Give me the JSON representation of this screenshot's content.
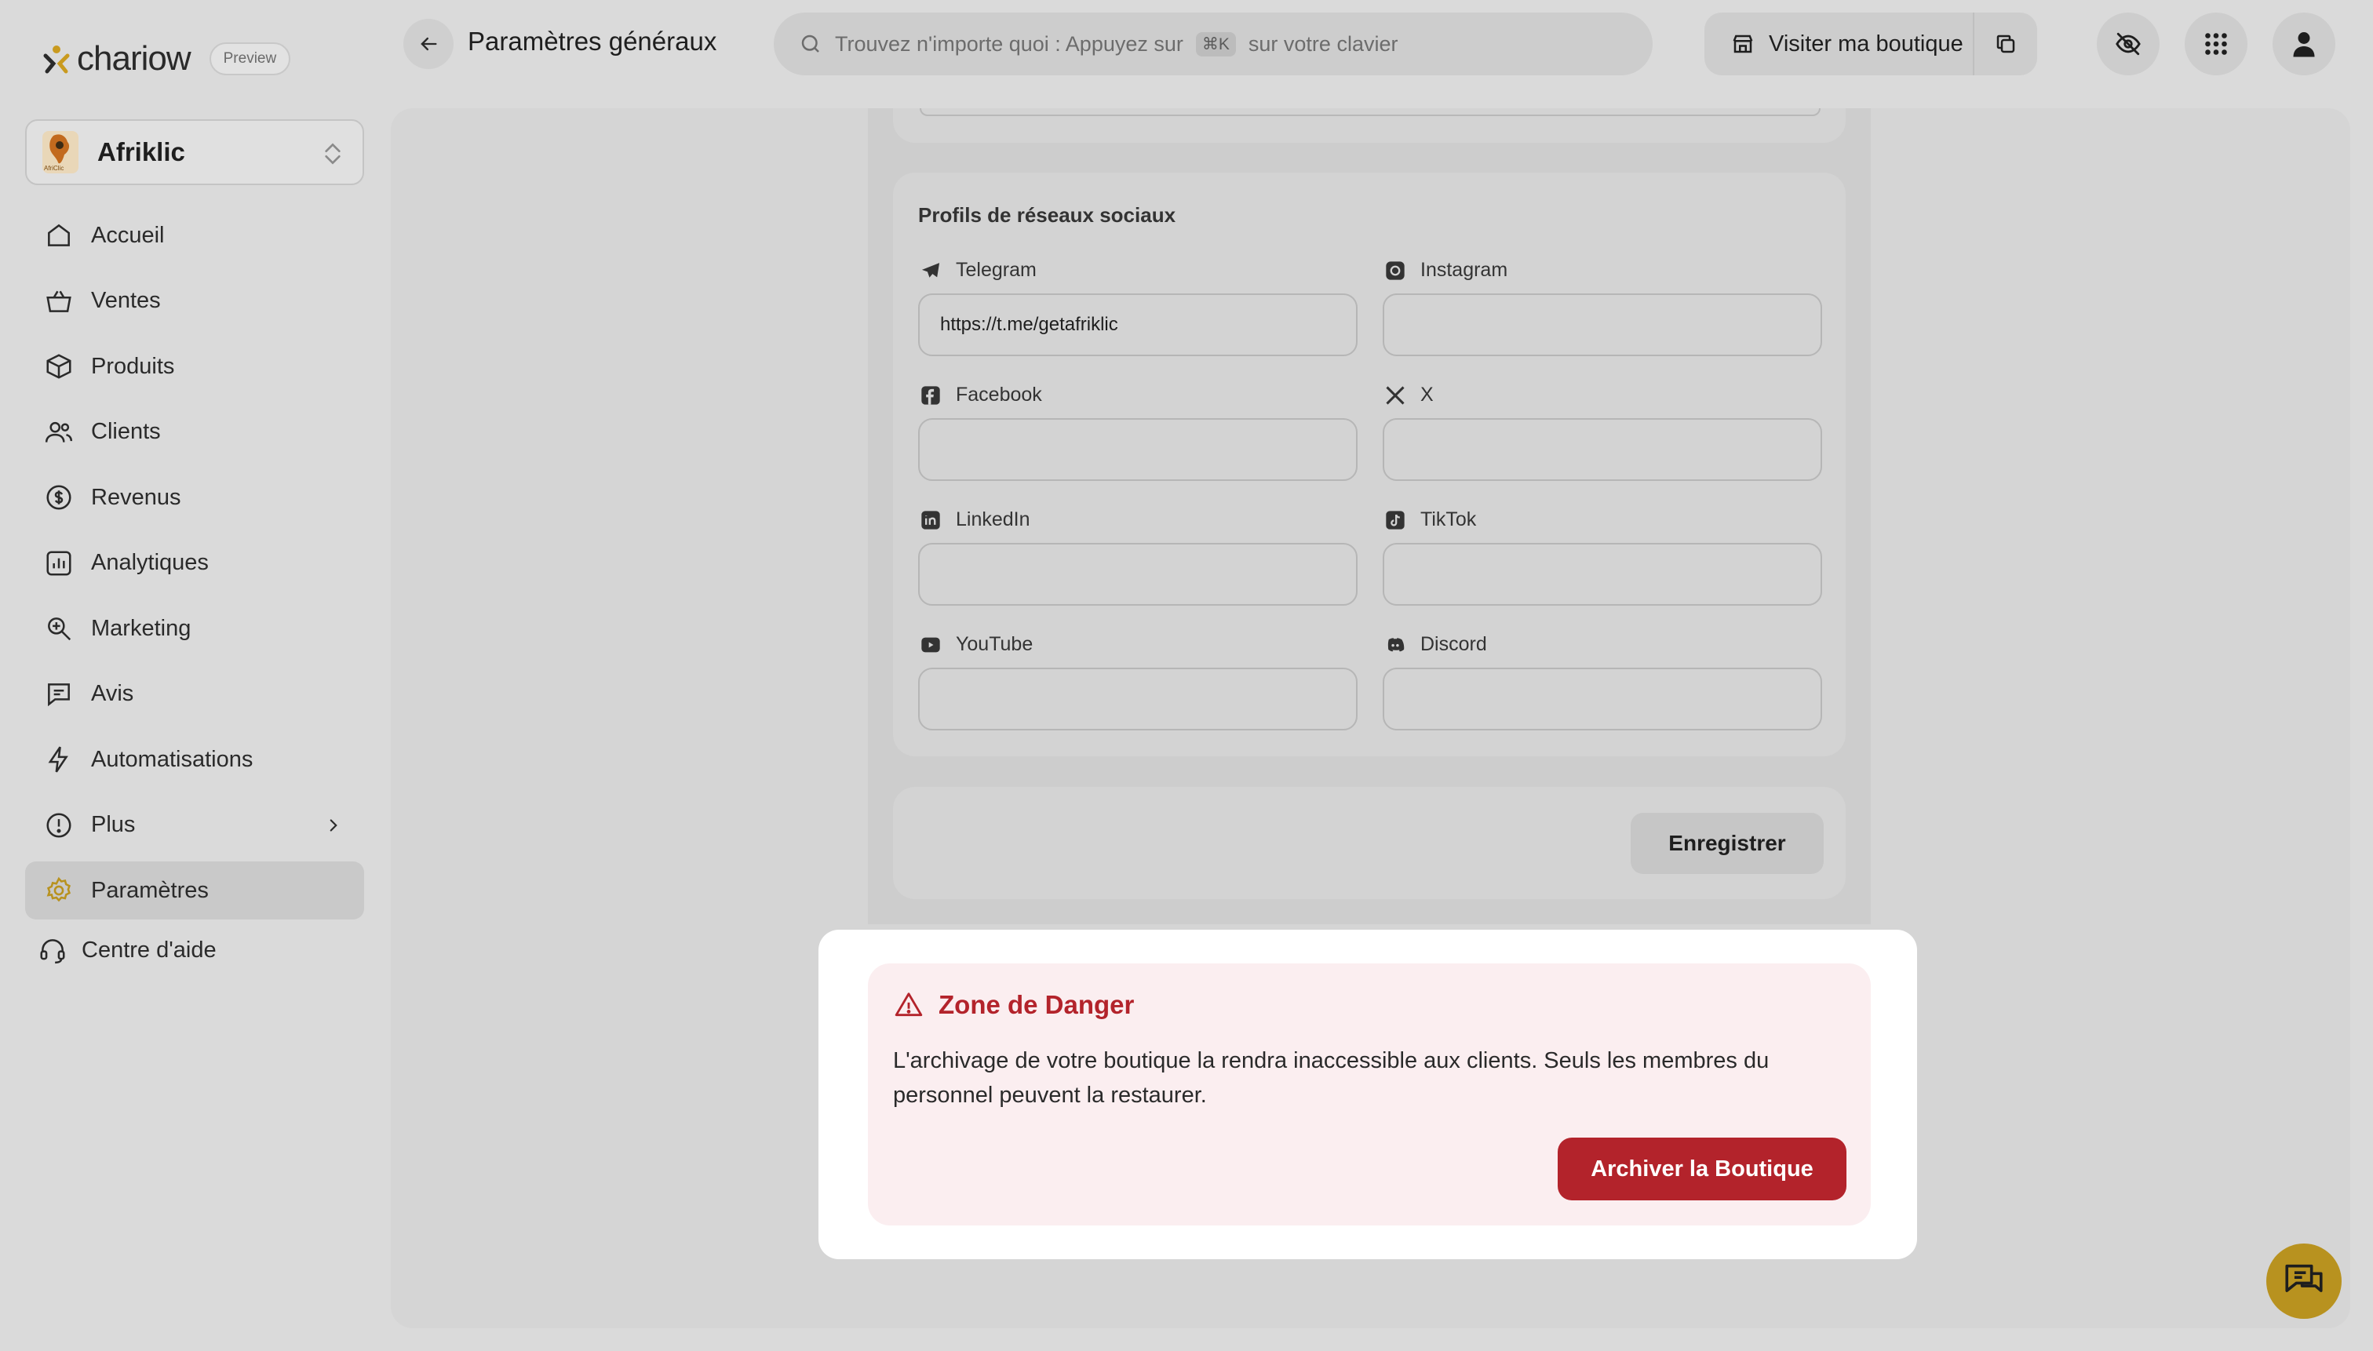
{
  "brand": {
    "logo_text": "chariow",
    "badge": "Preview"
  },
  "header": {
    "title": "Paramètres généraux",
    "search_prefix": "Trouvez n'importe quoi : Appuyez sur",
    "search_kbd": "⌘K",
    "search_suffix": "sur votre clavier",
    "visit_label": "Visiter ma boutique"
  },
  "store": {
    "name": "Afriklic",
    "logo_caption": "AfriClic"
  },
  "sidebar": {
    "items": [
      {
        "label": "Accueil",
        "icon": "home-icon"
      },
      {
        "label": "Ventes",
        "icon": "cart-icon"
      },
      {
        "label": "Produits",
        "icon": "box-icon"
      },
      {
        "label": "Clients",
        "icon": "users-icon"
      },
      {
        "label": "Revenus",
        "icon": "revenue-icon"
      },
      {
        "label": "Analytiques",
        "icon": "chart-icon"
      },
      {
        "label": "Marketing",
        "icon": "marketing-icon"
      },
      {
        "label": "Avis",
        "icon": "review-icon"
      },
      {
        "label": "Automatisations",
        "icon": "bolt-icon"
      },
      {
        "label": "Plus",
        "icon": "more-icon"
      },
      {
        "label": "Paramètres",
        "icon": "gear-icon",
        "active": true
      }
    ],
    "help_label": "Centre d'aide"
  },
  "social": {
    "title": "Profils de réseaux sociaux",
    "fields": {
      "telegram": {
        "label": "Telegram",
        "value": "https://t.me/getafriklic"
      },
      "instagram": {
        "label": "Instagram",
        "value": ""
      },
      "facebook": {
        "label": "Facebook",
        "value": ""
      },
      "x": {
        "label": "X",
        "value": ""
      },
      "linkedin": {
        "label": "LinkedIn",
        "value": ""
      },
      "tiktok": {
        "label": "TikTok",
        "value": ""
      },
      "youtube": {
        "label": "YouTube",
        "value": ""
      },
      "discord": {
        "label": "Discord",
        "value": ""
      }
    },
    "save_label": "Enregistrer"
  },
  "danger": {
    "title": "Zone de Danger",
    "text": "L'archivage de votre boutique la rendra inaccessible aux clients. Seuls les membres du personnel peuvent la restaurer.",
    "button": "Archiver la Boutique"
  },
  "colors": {
    "danger_red": "#b3232b",
    "danger_bg": "#fbeef0",
    "accent_gold": "#b8921f",
    "overlay_gray": "#dadada"
  }
}
